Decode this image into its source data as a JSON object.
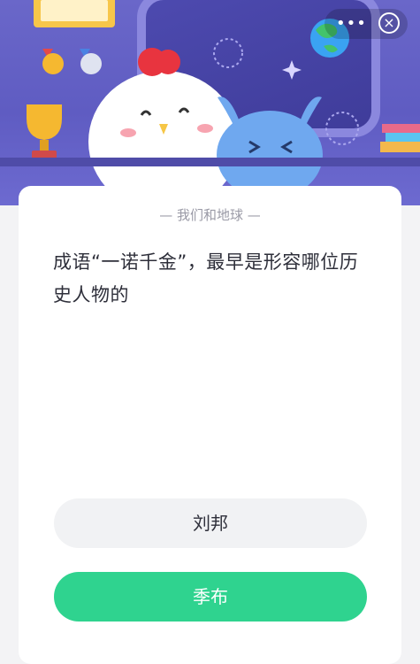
{
  "section_title": "— 我们和地球 —",
  "question": "成语“一诺千金”，最早是形容哪位历史人物的",
  "options": [
    {
      "label": "刘邦"
    },
    {
      "label": "季布"
    }
  ],
  "colors": {
    "header_bg": "#6a67c9",
    "selected_option": "#2fd38f"
  },
  "icons": [
    "more-icon",
    "close-icon",
    "trophy-icon",
    "medal-icon",
    "earth-icon",
    "chicken-mascot",
    "blue-alien-mascot"
  ]
}
